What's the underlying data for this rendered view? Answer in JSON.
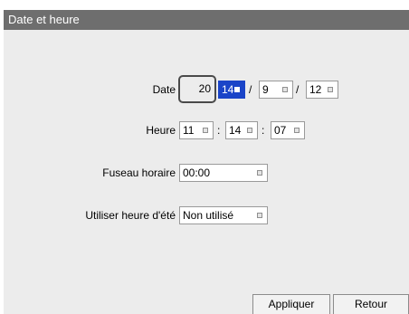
{
  "window": {
    "title": "Date et heure"
  },
  "date": {
    "label": "Date",
    "year_prefix": "20",
    "year_suffix": "14",
    "month": "9",
    "day": "12",
    "separator": "/"
  },
  "time": {
    "label": "Heure",
    "hour": "11",
    "minute": "14",
    "second": "07",
    "separator": ":"
  },
  "timezone": {
    "label": "Fuseau horaire",
    "value": "00:00"
  },
  "dst": {
    "label": "Utiliser heure d'été",
    "value": "Non utilisé"
  },
  "buttons": {
    "apply": "Appliquer",
    "back": "Retour"
  },
  "colors": {
    "titlebar": "#6e6e6e",
    "selection": "#1a44c8",
    "panel": "#ececec"
  }
}
